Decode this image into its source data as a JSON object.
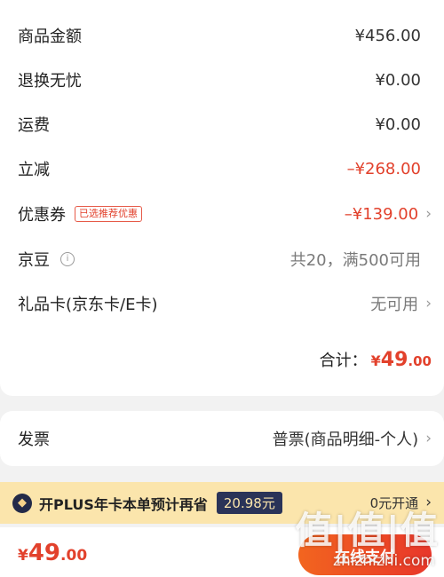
{
  "summary": {
    "goods_amount": {
      "label": "商品金额",
      "value": "¥456.00"
    },
    "return_worry_free": {
      "label": "退换无忧",
      "value": "¥0.00"
    },
    "shipping": {
      "label": "运费",
      "value": "¥0.00"
    },
    "instant_discount": {
      "label": "立减",
      "value": "–¥268.00"
    },
    "coupon": {
      "label": "优惠券",
      "tag": "已选推荐优惠",
      "value": "–¥139.00"
    },
    "jingdou": {
      "label": "京豆",
      "info_icon": "i",
      "value": "共20，满500可用"
    },
    "gift_card": {
      "label": "礼品卡(京东卡/E卡)",
      "value": "无可用"
    },
    "total": {
      "label": "合计：",
      "currency": "¥",
      "integer": "49",
      "decimal": ".00"
    }
  },
  "invoice": {
    "label": "发票",
    "value": "普票(商品明细-个人)"
  },
  "plus_bar": {
    "icon_text": "◆",
    "text": "开PLUS年卡本单预计再省",
    "save_amount": "20.98元",
    "open_label": "0元开通"
  },
  "bottom_bar": {
    "currency": "¥",
    "integer": "49",
    "decimal": ".00",
    "pay_label": "在线支付"
  },
  "watermark": {
    "text": "值|值|值",
    "url": "zhizhizhi.com"
  },
  "colors": {
    "accent_red": "#e2412c",
    "plus_gold": "#fbe5ac",
    "plus_navy": "#2a3358"
  }
}
